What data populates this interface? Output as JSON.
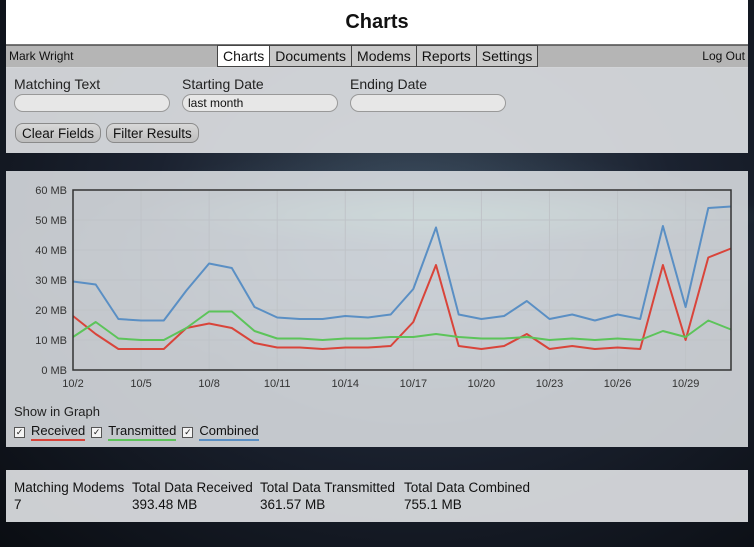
{
  "header": {
    "title": "Charts"
  },
  "navbar": {
    "user": "Mark Wright",
    "logout": "Log Out",
    "tabs": [
      {
        "label": "Charts",
        "active": true
      },
      {
        "label": "Documents",
        "active": false
      },
      {
        "label": "Modems",
        "active": false
      },
      {
        "label": "Reports",
        "active": false
      },
      {
        "label": "Settings",
        "active": false
      }
    ]
  },
  "filters": {
    "matching_text": {
      "label": "Matching Text",
      "value": ""
    },
    "starting_date": {
      "label": "Starting Date",
      "value": "last month"
    },
    "ending_date": {
      "label": "Ending Date",
      "value": ""
    },
    "clear_label": "Clear Fields",
    "filter_label": "Filter Results"
  },
  "legend": {
    "title": "Show in Graph",
    "items": [
      {
        "label": "Received",
        "checked": true,
        "color": "#d9443a"
      },
      {
        "label": "Transmitted",
        "checked": true,
        "color": "#5cc45a"
      },
      {
        "label": "Combined",
        "checked": true,
        "color": "#5a8fc4"
      }
    ]
  },
  "chart_data": {
    "type": "line",
    "x": [
      "10/2",
      "10/3",
      "10/4",
      "10/5",
      "10/6",
      "10/7",
      "10/8",
      "10/9",
      "10/10",
      "10/11",
      "10/12",
      "10/13",
      "10/14",
      "10/15",
      "10/16",
      "10/17",
      "10/18",
      "10/19",
      "10/20",
      "10/21",
      "10/22",
      "10/23",
      "10/24",
      "10/25",
      "10/26",
      "10/27",
      "10/28",
      "10/29",
      "10/30",
      "10/31"
    ],
    "x_tick_labels": [
      "10/2",
      "10/5",
      "10/8",
      "10/11",
      "10/14",
      "10/17",
      "10/20",
      "10/23",
      "10/26",
      "10/29"
    ],
    "y_tick_labels": [
      "0 MB",
      "10 MB",
      "20 MB",
      "30 MB",
      "40 MB",
      "50 MB",
      "60 MB"
    ],
    "ylim": [
      0,
      60
    ],
    "grid": true,
    "series": [
      {
        "name": "Received",
        "color": "#d9443a",
        "values": [
          18,
          12,
          7,
          7,
          7,
          14,
          15.5,
          14,
          9,
          7.5,
          7.5,
          7,
          7.5,
          7.5,
          8,
          16,
          35,
          8,
          7,
          8,
          12,
          7,
          8,
          7,
          7.5,
          7,
          35,
          10,
          37.5,
          40.5
        ]
      },
      {
        "name": "Transmitted",
        "color": "#5cc45a",
        "values": [
          11,
          16,
          10.5,
          10,
          10,
          14,
          19.5,
          19.5,
          13,
          10.5,
          10.5,
          10,
          10.5,
          10.5,
          11,
          11,
          12,
          11,
          10.5,
          10.5,
          11,
          10,
          10.5,
          10,
          10.5,
          10,
          13,
          11,
          16.5,
          13.5
        ]
      },
      {
        "name": "Combined",
        "color": "#5a8fc4",
        "values": [
          29.5,
          28.5,
          17,
          16.5,
          16.5,
          26.5,
          35.5,
          34,
          21,
          17.5,
          17,
          17,
          18,
          17.5,
          18.5,
          27,
          47.5,
          18.5,
          17,
          18,
          23,
          17,
          18.5,
          16.5,
          18.5,
          17,
          48,
          21,
          54,
          54.5
        ]
      }
    ]
  },
  "stats": [
    {
      "label": "Matching Modems",
      "value": "7"
    },
    {
      "label": "Total Data Received",
      "value": "393.48 MB"
    },
    {
      "label": "Total Data Transmitted",
      "value": "361.57 MB"
    },
    {
      "label": "Total Data Combined",
      "value": "755.1 MB"
    }
  ]
}
